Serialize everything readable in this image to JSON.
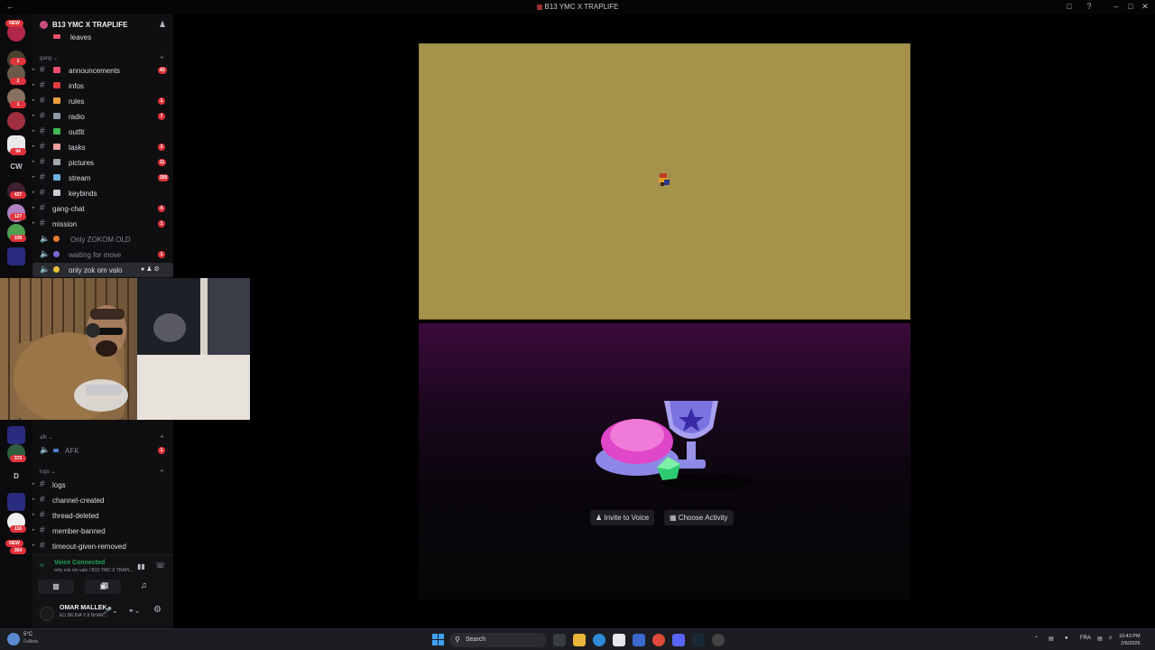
{
  "window": {
    "title": "B13 YMC X TRAPLIFE"
  },
  "rail": {
    "badges": [
      "NEW",
      "1",
      "2",
      "1",
      "94",
      "427",
      "127",
      "339",
      "373",
      "116",
      "NEW",
      "304"
    ],
    "texts": [
      "CW",
      "D"
    ]
  },
  "server": {
    "name": "B13 YMC X TRAPLIFE",
    "top_channel": "leaves"
  },
  "categories": {
    "gang": "gang",
    "afk": "afk",
    "logs": "logs"
  },
  "channels": [
    {
      "label": "announcements",
      "badge": "43",
      "emoji": "#e94e6b"
    },
    {
      "label": "infos",
      "badge": "",
      "emoji": "#e03c3c"
    },
    {
      "label": "rules",
      "badge": "1",
      "emoji": "#f0a040"
    },
    {
      "label": "radio",
      "badge": "7",
      "emoji": "#8c9aa8"
    },
    {
      "label": "outfit",
      "badge": "",
      "emoji": "#3fb950"
    },
    {
      "label": "tasks",
      "badge": "3",
      "emoji": "#e8a0a0"
    },
    {
      "label": "pictures",
      "badge": "11",
      "emoji": "#a0a8b0"
    },
    {
      "label": "stream",
      "badge": "209",
      "emoji": "#6ab0e0"
    },
    {
      "label": "keybinds",
      "badge": "",
      "emoji": "#c8ccd0"
    },
    {
      "label": "gang-chat",
      "badge": "4",
      "emoji": ""
    },
    {
      "label": "mission",
      "badge": "1",
      "emoji": ""
    }
  ],
  "voice_channels": [
    {
      "label": "Only ZOKOM OLD",
      "badge": ""
    },
    {
      "label": "waiting for move",
      "badge": "1"
    },
    {
      "label": "only zok om valo",
      "badge": ""
    }
  ],
  "afk_channel": {
    "label": "AFK",
    "badge": "1"
  },
  "log_channels": [
    "logs",
    "channel-created",
    "thread-deleted",
    "member-banned",
    "timeout-given-removed"
  ],
  "voice": {
    "status": "Voice Connected",
    "sub": "only zok om valo / B13 YMC X TRAPL..."
  },
  "user": {
    "name": "OMAR MALLEK",
    "sub": "ELI BEJNA YJI NHAR..."
  },
  "activity": {
    "invite_label": "Invite to Voice",
    "choose_label": "Choose Activity"
  },
  "taskbar": {
    "weather_temp": "5°C",
    "weather_desc": "Fallbds",
    "search_placeholder": "Search",
    "lang": "FRA",
    "time": "10:43 PM",
    "date": "2/6/2026"
  }
}
